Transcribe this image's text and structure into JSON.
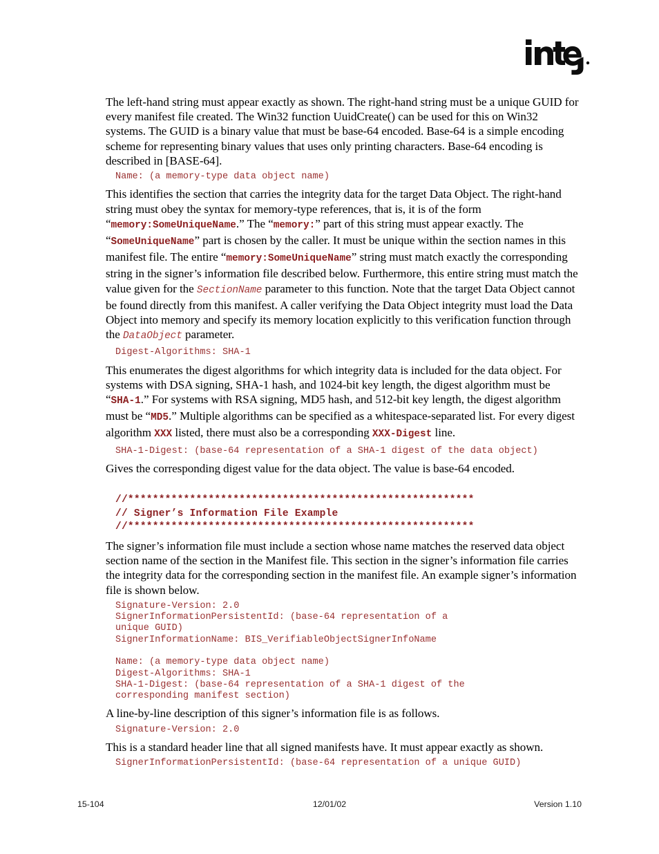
{
  "logo": {
    "name": "intel-logo",
    "wordmark": "intel"
  },
  "body": {
    "para_1": "The left-hand string must appear exactly as shown.  The right-hand string must be a unique GUID for every manifest file created.  The Win32 function UuidCreate() can be used for this on Win32 systems.  The GUID is a binary value that must be base-64 encoded.  Base-64 is a simple encoding scheme for representing binary values that uses only printing characters.  Base-64 encoding is described in [BASE-64].",
    "code_1": "Name: (a memory-type data object name)",
    "para_2_a": "This identifies the section that carries the integrity data for the target Data Object.  The right-hand string must obey the syntax for memory-type references, that is, it is of the form “",
    "para_2_code_1": "memory:SomeUniqueName",
    "para_2_b": ".”  The “",
    "para_2_code_2": "memory:",
    "para_2_c": "” part of this string must appear exactly.  The “",
    "para_2_code_3": "SomeUniqueName",
    "para_2_d": "” part is chosen by the caller.  It must be unique within the section names in this manifest file.  The entire “",
    "para_2_code_4": "memory:SomeUniqueName",
    "para_2_e": "” string must match exactly the corresponding string in the signer’s information file described below.  Furthermore, this entire string must match the value given for the ",
    "para_2_code_5": "SectionName",
    "para_2_f": " parameter to this function.  Note that the target Data Object cannot be found directly from this manifest.  A caller verifying the Data Object integrity must load the Data Object into memory and specify its memory location explicitly to this verification function through the ",
    "para_2_code_6": "DataObject",
    "para_2_g": " parameter.",
    "code_2": "Digest-Algorithms: SHA-1",
    "para_3_a": "This enumerates the digest algorithms for which integrity data is included for the data object.  For systems with DSA signing, SHA-1 hash, and 1024-bit key length, the digest algorithm must be “",
    "para_3_code_1": "SHA-1",
    "para_3_b": ".”  For systems with RSA signing, MD5 hash, and 512-bit key length, the digest algorithm must be “",
    "para_3_code_2": "MD5",
    "para_3_c": ".”  Multiple algorithms can be specified as a whitespace-separated list.  For every digest algorithm ",
    "para_3_code_3": "XXX",
    "para_3_d": " listed, there must also be a corresponding ",
    "para_3_code_4": "XXX-Digest",
    "para_3_e": " line.",
    "code_3": "SHA-1-Digest: (base-64 representation of a SHA-1 digest of the data object)",
    "para_4": "Gives the corresponding digest value for the data object.  The value is base-64 encoded.",
    "banner": "//********************************************************\n// Signer’s Information File Example\n//********************************************************",
    "para_5": "The signer’s information file must include a section whose name matches the reserved data object section name of the section in the Manifest file.  This section in the signer’s information file carries the integrity data for the corresponding section in the manifest file.  An example signer’s information file is shown below.",
    "code_4": "Signature-Version: 2.0\nSignerInformationPersistentId: (base-64 representation of a\nunique GUID)\nSignerInformationName: BIS_VerifiableObjectSignerInfoName\n\nName: (a memory-type data object name)\nDigest-Algorithms: SHA-1\nSHA-1-Digest: (base-64 representation of a SHA-1 digest of the\ncorresponding manifest section)",
    "para_6": "A line-by-line description of this signer’s information file is as follows.",
    "code_5": "Signature-Version: 2.0",
    "para_7": "This is a standard header line that all signed manifests have.  It must appear exactly as shown.",
    "code_6": "SignerInformationPersistentId: (base-64 representation of a unique GUID)"
  },
  "footer": {
    "page_number": "15-104",
    "date": "12/01/02",
    "version": "Version 1.10"
  },
  "colors": {
    "code_red": "#9a3232",
    "inline_code_red": "#8c1f20",
    "banner_red": "#8c2224",
    "body_black": "#000000"
  }
}
